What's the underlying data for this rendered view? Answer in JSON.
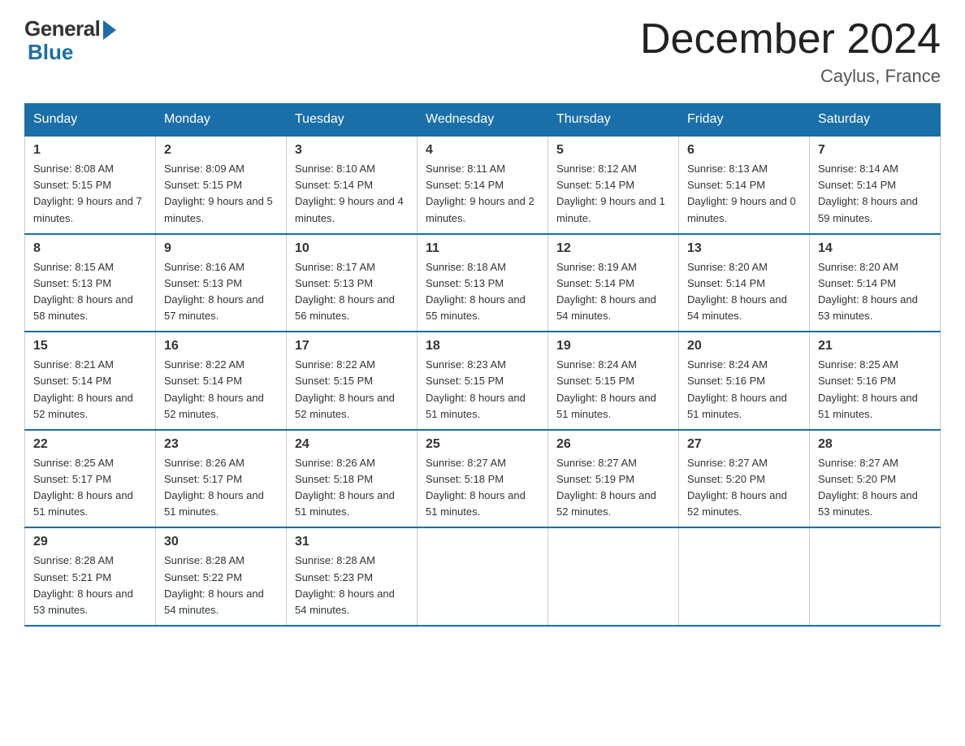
{
  "header": {
    "logo_general": "General",
    "logo_blue": "Blue",
    "month_title": "December 2024",
    "location": "Caylus, France"
  },
  "days_of_week": [
    "Sunday",
    "Monday",
    "Tuesday",
    "Wednesday",
    "Thursday",
    "Friday",
    "Saturday"
  ],
  "weeks": [
    [
      {
        "num": "1",
        "sunrise": "8:08 AM",
        "sunset": "5:15 PM",
        "daylight": "9 hours and 7 minutes."
      },
      {
        "num": "2",
        "sunrise": "8:09 AM",
        "sunset": "5:15 PM",
        "daylight": "9 hours and 5 minutes."
      },
      {
        "num": "3",
        "sunrise": "8:10 AM",
        "sunset": "5:14 PM",
        "daylight": "9 hours and 4 minutes."
      },
      {
        "num": "4",
        "sunrise": "8:11 AM",
        "sunset": "5:14 PM",
        "daylight": "9 hours and 2 minutes."
      },
      {
        "num": "5",
        "sunrise": "8:12 AM",
        "sunset": "5:14 PM",
        "daylight": "9 hours and 1 minute."
      },
      {
        "num": "6",
        "sunrise": "8:13 AM",
        "sunset": "5:14 PM",
        "daylight": "9 hours and 0 minutes."
      },
      {
        "num": "7",
        "sunrise": "8:14 AM",
        "sunset": "5:14 PM",
        "daylight": "8 hours and 59 minutes."
      }
    ],
    [
      {
        "num": "8",
        "sunrise": "8:15 AM",
        "sunset": "5:13 PM",
        "daylight": "8 hours and 58 minutes."
      },
      {
        "num": "9",
        "sunrise": "8:16 AM",
        "sunset": "5:13 PM",
        "daylight": "8 hours and 57 minutes."
      },
      {
        "num": "10",
        "sunrise": "8:17 AM",
        "sunset": "5:13 PM",
        "daylight": "8 hours and 56 minutes."
      },
      {
        "num": "11",
        "sunrise": "8:18 AM",
        "sunset": "5:13 PM",
        "daylight": "8 hours and 55 minutes."
      },
      {
        "num": "12",
        "sunrise": "8:19 AM",
        "sunset": "5:14 PM",
        "daylight": "8 hours and 54 minutes."
      },
      {
        "num": "13",
        "sunrise": "8:20 AM",
        "sunset": "5:14 PM",
        "daylight": "8 hours and 54 minutes."
      },
      {
        "num": "14",
        "sunrise": "8:20 AM",
        "sunset": "5:14 PM",
        "daylight": "8 hours and 53 minutes."
      }
    ],
    [
      {
        "num": "15",
        "sunrise": "8:21 AM",
        "sunset": "5:14 PM",
        "daylight": "8 hours and 52 minutes."
      },
      {
        "num": "16",
        "sunrise": "8:22 AM",
        "sunset": "5:14 PM",
        "daylight": "8 hours and 52 minutes."
      },
      {
        "num": "17",
        "sunrise": "8:22 AM",
        "sunset": "5:15 PM",
        "daylight": "8 hours and 52 minutes."
      },
      {
        "num": "18",
        "sunrise": "8:23 AM",
        "sunset": "5:15 PM",
        "daylight": "8 hours and 51 minutes."
      },
      {
        "num": "19",
        "sunrise": "8:24 AM",
        "sunset": "5:15 PM",
        "daylight": "8 hours and 51 minutes."
      },
      {
        "num": "20",
        "sunrise": "8:24 AM",
        "sunset": "5:16 PM",
        "daylight": "8 hours and 51 minutes."
      },
      {
        "num": "21",
        "sunrise": "8:25 AM",
        "sunset": "5:16 PM",
        "daylight": "8 hours and 51 minutes."
      }
    ],
    [
      {
        "num": "22",
        "sunrise": "8:25 AM",
        "sunset": "5:17 PM",
        "daylight": "8 hours and 51 minutes."
      },
      {
        "num": "23",
        "sunrise": "8:26 AM",
        "sunset": "5:17 PM",
        "daylight": "8 hours and 51 minutes."
      },
      {
        "num": "24",
        "sunrise": "8:26 AM",
        "sunset": "5:18 PM",
        "daylight": "8 hours and 51 minutes."
      },
      {
        "num": "25",
        "sunrise": "8:27 AM",
        "sunset": "5:18 PM",
        "daylight": "8 hours and 51 minutes."
      },
      {
        "num": "26",
        "sunrise": "8:27 AM",
        "sunset": "5:19 PM",
        "daylight": "8 hours and 52 minutes."
      },
      {
        "num": "27",
        "sunrise": "8:27 AM",
        "sunset": "5:20 PM",
        "daylight": "8 hours and 52 minutes."
      },
      {
        "num": "28",
        "sunrise": "8:27 AM",
        "sunset": "5:20 PM",
        "daylight": "8 hours and 53 minutes."
      }
    ],
    [
      {
        "num": "29",
        "sunrise": "8:28 AM",
        "sunset": "5:21 PM",
        "daylight": "8 hours and 53 minutes."
      },
      {
        "num": "30",
        "sunrise": "8:28 AM",
        "sunset": "5:22 PM",
        "daylight": "8 hours and 54 minutes."
      },
      {
        "num": "31",
        "sunrise": "8:28 AM",
        "sunset": "5:23 PM",
        "daylight": "8 hours and 54 minutes."
      },
      null,
      null,
      null,
      null
    ]
  ],
  "labels": {
    "sunrise": "Sunrise:",
    "sunset": "Sunset:",
    "daylight": "Daylight:"
  }
}
